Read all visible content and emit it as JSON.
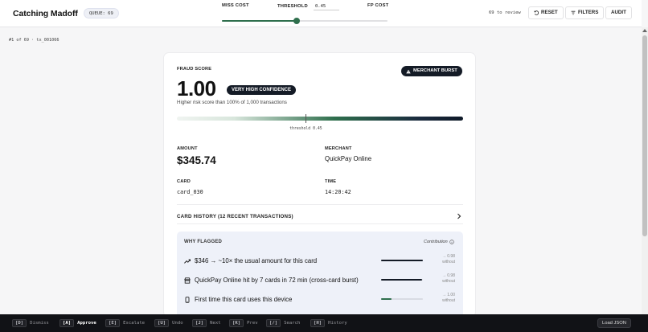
{
  "header": {
    "title": "Catching Madoff",
    "queue_badge": "QUEUE: 69",
    "miss_cost_label": "MISS COST",
    "threshold_label": "THRESHOLD",
    "threshold_value": "0.45",
    "fp_cost_label": "FP COST",
    "slider_position": 0.45,
    "to_review": "69 to review",
    "reset_label": "RESET",
    "filters_label": "FILTERS",
    "audit_label": "AUDIT"
  },
  "breadcrumb": "#1 of 69 · tx_001066",
  "card": {
    "fraud_score_label": "FRAUD SCORE",
    "score": "1.00",
    "confidence_badge": "VERY HIGH CONFIDENCE",
    "merchant_burst_badge": "MERCHANT BURST",
    "subtext": "Higher risk score than 100% of 1,000 transactions",
    "threshold_caption": "threshold 0.45",
    "threshold_fraction": 0.45,
    "amount_label": "AMOUNT",
    "amount": "$345.74",
    "merchant_label": "MERCHANT",
    "merchant": "QuickPay Online",
    "card_label": "CARD",
    "card_id": "card_030",
    "time_label": "TIME",
    "time": "14:20:42",
    "history_label": "CARD HISTORY (12 RECENT TRANSACTIONS)"
  },
  "why_flagged": {
    "title": "WHY FLAGGED",
    "contribution_label": "Contribution",
    "reasons": [
      {
        "icon": "trend-up-icon",
        "text": "$346 → ~10× the usual amount for this card",
        "delta": "→ 0.98",
        "without": "without",
        "strength": 1.0,
        "color": "#141b26"
      },
      {
        "icon": "store-icon",
        "text": "QuickPay Online hit by 7 cards in 72 min (cross-card burst)",
        "delta": "→ 0.98",
        "without": "without",
        "strength": 0.98,
        "color": "#141b26"
      },
      {
        "icon": "phone-icon",
        "text": "First time this card uses this device",
        "delta": "→ 1.00",
        "without": "without",
        "strength": 0.25,
        "color": "#2f6f4d"
      }
    ]
  },
  "shortcuts": [
    {
      "key": "[D]",
      "label": "Dismiss",
      "active": false
    },
    {
      "key": "[A]",
      "label": "Approve",
      "active": true
    },
    {
      "key": "[E]",
      "label": "Escalate",
      "active": false
    },
    {
      "key": "[U]",
      "label": "Undo",
      "active": false
    },
    {
      "key": "[J]",
      "label": "Next",
      "active": false
    },
    {
      "key": "[K]",
      "label": "Prev",
      "active": false
    },
    {
      "key": "[/]",
      "label": "Search",
      "active": false
    },
    {
      "key": "[H]",
      "label": "History",
      "active": false
    }
  ],
  "load_json_label": "Load JSON"
}
